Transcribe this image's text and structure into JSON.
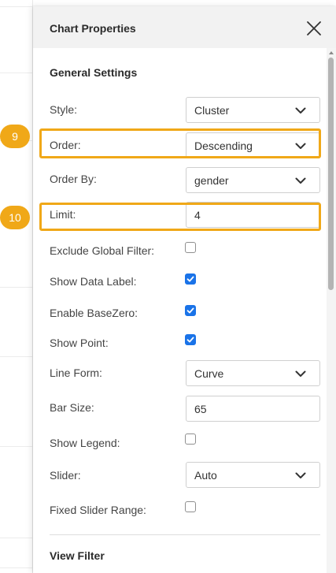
{
  "panel": {
    "title": "Chart Properties",
    "close_icon": "close-icon"
  },
  "general_settings": {
    "title": "General Settings",
    "style": {
      "label": "Style:",
      "value": "Cluster"
    },
    "order": {
      "label": "Order:",
      "value": "Descending"
    },
    "order_by": {
      "label": "Order By:",
      "value": "gender"
    },
    "limit": {
      "label": "Limit:",
      "value": "4"
    },
    "exclude_global_filter": {
      "label": "Exclude Global Filter:",
      "checked": false
    },
    "show_data_label": {
      "label": "Show Data Label:",
      "checked": true
    },
    "enable_basezero": {
      "label": "Enable BaseZero:",
      "checked": true
    },
    "show_point": {
      "label": "Show Point:",
      "checked": true
    },
    "line_form": {
      "label": "Line Form:",
      "value": "Curve"
    },
    "bar_size": {
      "label": "Bar Size:",
      "value": "65"
    },
    "show_legend": {
      "label": "Show Legend:",
      "checked": false
    },
    "slider": {
      "label": "Slider:",
      "value": "Auto"
    },
    "fixed_slider_range": {
      "label": "Fixed Slider Range:",
      "checked": false
    }
  },
  "view_filter": {
    "title": "View Filter"
  },
  "annotations": {
    "badge_order": "9",
    "badge_limit": "10",
    "highlight_color": "#f0a818"
  },
  "colors": {
    "accent": "#1a73e8",
    "header_bg": "#f2f2f2"
  }
}
